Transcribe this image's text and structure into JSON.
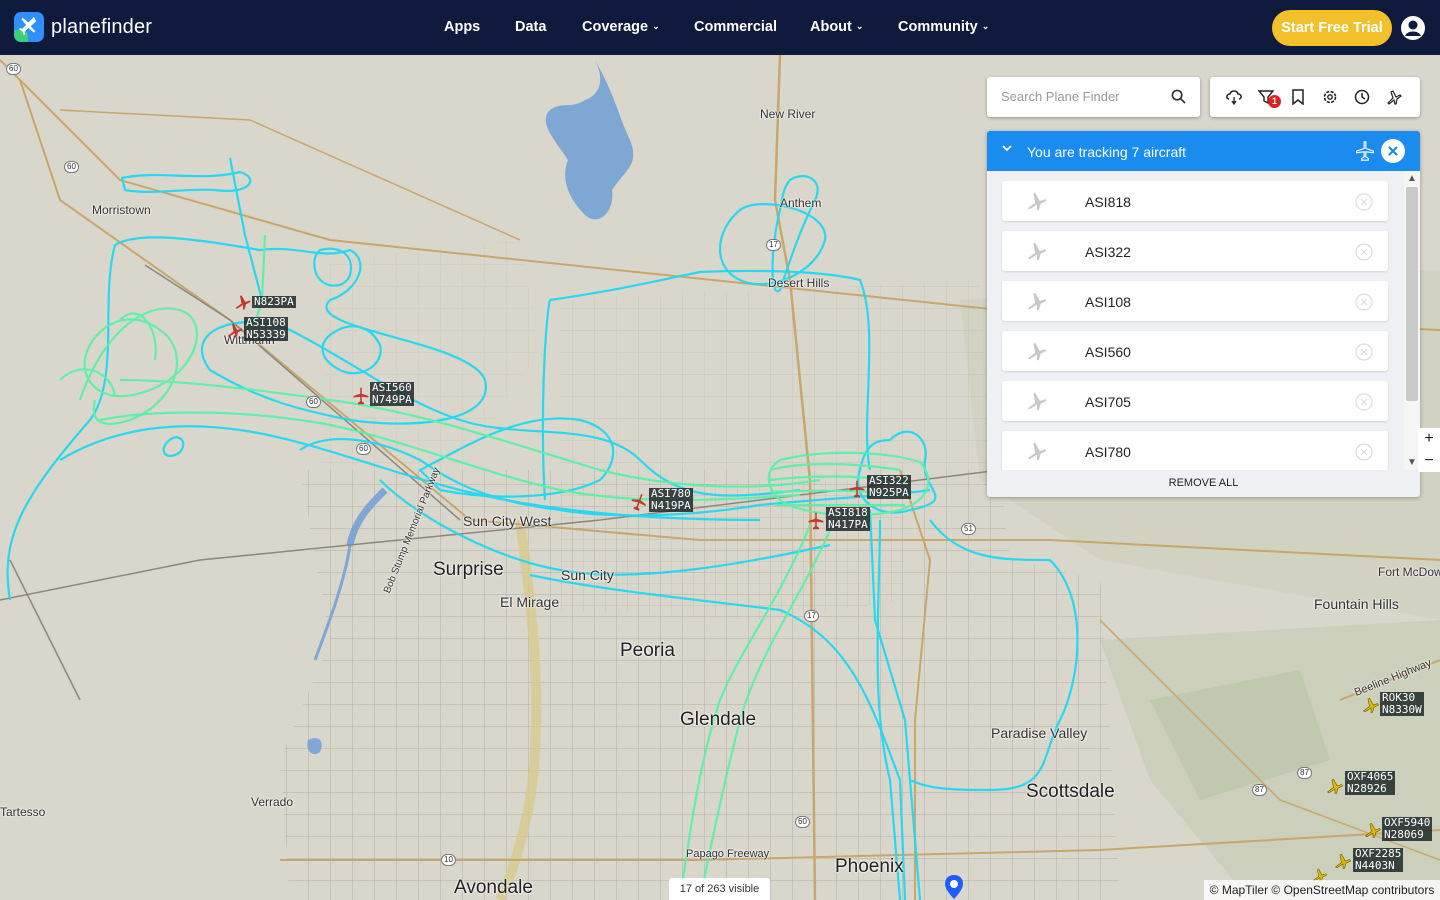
{
  "brand": {
    "name_regular": "plane",
    "name_bold": "finder"
  },
  "nav": {
    "items": [
      {
        "label": "Apps",
        "dropdown": false
      },
      {
        "label": "Data",
        "dropdown": false
      },
      {
        "label": "Coverage",
        "dropdown": true
      },
      {
        "label": "Commercial",
        "dropdown": false
      },
      {
        "label": "About",
        "dropdown": true
      },
      {
        "label": "Community",
        "dropdown": true
      }
    ],
    "cta": "Start Free Trial"
  },
  "search": {
    "placeholder": "Search Plane Finder",
    "value": ""
  },
  "toolbar": {
    "icons": [
      "weather-icon",
      "filter-icon",
      "bookmark-icon",
      "settings-icon",
      "history-icon",
      "3d-view-icon"
    ],
    "filter_badge": "1"
  },
  "tracking": {
    "title": "You are tracking 7 aircraft",
    "aircraft": [
      "ASI818",
      "ASI322",
      "ASI108",
      "ASI560",
      "ASI705",
      "ASI780"
    ],
    "remove_all": "REMOVE ALL"
  },
  "zoom": {
    "in": "+",
    "out": "−"
  },
  "visible_count": "17 of 263 visible",
  "attribution": "© MapTiler © OpenStreetMap contributors",
  "map": {
    "places": [
      {
        "name": "New River",
        "size": "small"
      },
      {
        "name": "Morristown",
        "size": "small"
      },
      {
        "name": "Anthem",
        "size": "small"
      },
      {
        "name": "Desert Hills",
        "size": "small"
      },
      {
        "name": "Wittmann",
        "size": "small"
      },
      {
        "name": "Sun City West",
        "size": "mid"
      },
      {
        "name": "Surprise",
        "size": "big"
      },
      {
        "name": "Sun City",
        "size": "mid"
      },
      {
        "name": "El Mirage",
        "size": "mid"
      },
      {
        "name": "Peoria",
        "size": "big"
      },
      {
        "name": "Glendale",
        "size": "big"
      },
      {
        "name": "Fort McDowell",
        "size": "small"
      },
      {
        "name": "Fountain Hills",
        "size": "mid"
      },
      {
        "name": "Paradise Valley",
        "size": "mid"
      },
      {
        "name": "Scottsdale",
        "size": "big"
      },
      {
        "name": "Verrado",
        "size": "small"
      },
      {
        "name": "Tartesso",
        "size": "small"
      },
      {
        "name": "Avondale",
        "size": "big"
      },
      {
        "name": "Phoenix",
        "size": "big"
      },
      {
        "name": "Papago Freeway",
        "size": "small"
      },
      {
        "name": "Beeline Highway",
        "size": "small"
      },
      {
        "name": "Bob Stump Memorial Parkway",
        "size": "small"
      }
    ],
    "shields": [
      "60",
      "60",
      "60",
      "60",
      "17",
      "17",
      "51",
      "87",
      "87",
      "60",
      "10"
    ],
    "aircraft_labels": [
      {
        "callsign": "N823PA",
        "reg": "",
        "color": "#c0392b"
      },
      {
        "callsign": "ASI108",
        "reg": "N53339",
        "color": "#c0392b"
      },
      {
        "callsign": "ASI560",
        "reg": "N749PA",
        "color": "#c0392b"
      },
      {
        "callsign": "ASI780",
        "reg": "N419PA",
        "color": "#c0392b"
      },
      {
        "callsign": "ASI322",
        "reg": "N925PA",
        "color": "#c0392b"
      },
      {
        "callsign": "ASI818",
        "reg": "N417PA",
        "color": "#c0392b"
      },
      {
        "callsign": "ROK30",
        "reg": "N8330W",
        "color": "#e0b800"
      },
      {
        "callsign": "OXF4065",
        "reg": "N28926",
        "color": "#e0b800"
      },
      {
        "callsign": "OXF5940",
        "reg": "N28069",
        "color": "#e0b800"
      },
      {
        "callsign": "OXF2285",
        "reg": "N4403N",
        "color": "#e0b800"
      }
    ],
    "colors": {
      "track_cyan": "#1fd8f2",
      "track_green": "#5cf0a8",
      "water": "#7fa7d4",
      "header": "#0f1a3d",
      "accent": "#1a8cf0",
      "cta": "#f2c02a"
    }
  }
}
